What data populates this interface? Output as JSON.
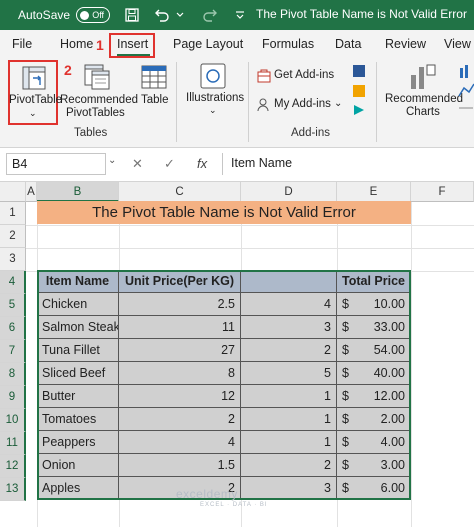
{
  "titlebar": {
    "autosave_label": "AutoSave",
    "autosave_state": "Off",
    "doc_title": "The Pivot Table Name is Not Valid Error"
  },
  "tabs": [
    "File",
    "Home",
    "Insert",
    "Page Layout",
    "Formulas",
    "Data",
    "Review",
    "View"
  ],
  "annotations": {
    "step1": "1",
    "step2": "2"
  },
  "ribbon": {
    "pivottable_label": "PivotTable",
    "recommended_pivottables_line1": "Recommended",
    "recommended_pivottables_line2": "PivotTables",
    "table_label": "Table",
    "tables_group": "Tables",
    "illustrations_label": "Illustrations",
    "get_addins_label": "Get Add-ins",
    "my_addins_label": "My Add-ins",
    "addins_group": "Add-ins",
    "recommended_charts_line1": "Recommended",
    "recommended_charts_line2": "Charts"
  },
  "formula_bar": {
    "name_box": "B4",
    "cancel_glyph": "✕",
    "enter_glyph": "✓",
    "fx_label": "fx",
    "formula": "Item Name"
  },
  "columns": [
    "A",
    "B",
    "C",
    "D",
    "E",
    "F"
  ],
  "rows": [
    "1",
    "2",
    "3",
    "4",
    "5",
    "6",
    "7",
    "8",
    "9",
    "10",
    "11",
    "12",
    "13"
  ],
  "sheet": {
    "title": "The Pivot Table Name is Not Valid Error",
    "headers": [
      "Item Name",
      "Unit Price(Per KG)",
      "",
      "Total Price"
    ],
    "data": [
      {
        "item": "Chicken",
        "price": "2.5",
        "qty": "4",
        "total": "10.00"
      },
      {
        "item": "Salmon Steak",
        "price": "11",
        "qty": "3",
        "total": "33.00"
      },
      {
        "item": "Tuna Fillet",
        "price": "27",
        "qty": "2",
        "total": "54.00"
      },
      {
        "item": "Sliced Beef",
        "price": "8",
        "qty": "5",
        "total": "40.00"
      },
      {
        "item": "Butter",
        "price": "12",
        "qty": "1",
        "total": "12.00"
      },
      {
        "item": "Tomatoes",
        "price": "2",
        "qty": "1",
        "total": "2.00"
      },
      {
        "item": "Peappers",
        "price": "4",
        "qty": "1",
        "total": "4.00"
      },
      {
        "item": "Onion",
        "price": "1.5",
        "qty": "2",
        "total": "3.00"
      },
      {
        "item": "Apples",
        "price": "2",
        "qty": "3",
        "total": "6.00"
      }
    ],
    "currency": "$"
  },
  "watermark": {
    "brand": "exceldemy",
    "tagline": "EXCEL · DATA · BI"
  },
  "colors": {
    "excel_green": "#217346",
    "annotation_red": "#e0322e",
    "title_fill": "#f4b183",
    "header_fill": "#adb9ca",
    "body_fill": "#d0d0d0"
  }
}
